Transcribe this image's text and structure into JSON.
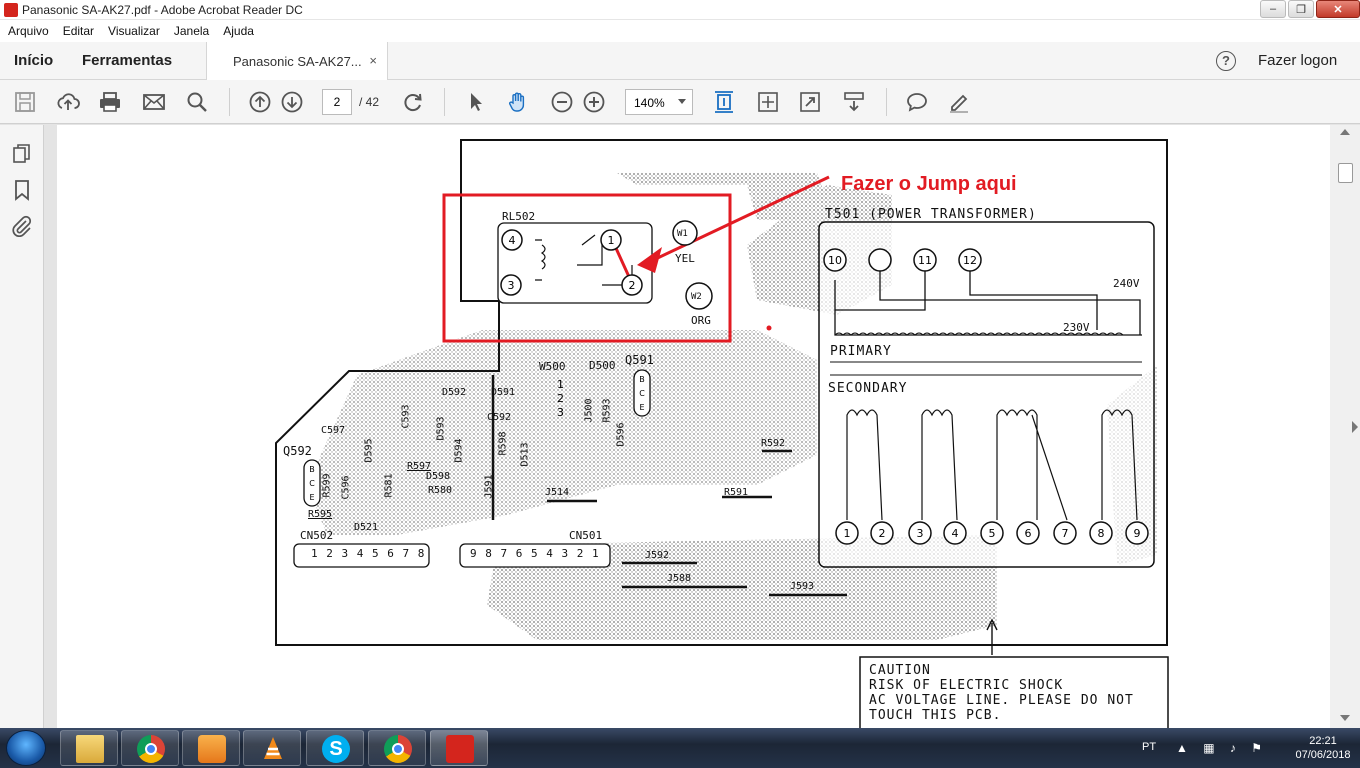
{
  "window": {
    "title": "Panasonic SA-AK27.pdf - Adobe Acrobat Reader DC"
  },
  "menu": [
    "Arquivo",
    "Editar",
    "Visualizar",
    "Janela",
    "Ajuda"
  ],
  "tabs": {
    "home": "Início",
    "tools": "Ferramentas",
    "document": "Panasonic SA-AK27...",
    "close": "×"
  },
  "account": {
    "help": "?",
    "login": "Fazer logon"
  },
  "toolbar": {
    "page_current": "2",
    "page_total": "/ 42",
    "zoom": "140%"
  },
  "document": {
    "annotation": "Fazer o Jump aqui",
    "caution": [
      "CAUTION",
      "RISK OF ELECTRIC SHOCK",
      "AC VOLTAGE LINE. PLEASE DO NOT",
      "TOUCH THIS PCB."
    ],
    "labels": {
      "rl502": "RL502",
      "t501": "T501 (POWER TRANSFORMER)",
      "primary": "PRIMARY",
      "secondary": "SECONDARY",
      "v240": "240V",
      "v230": "230V",
      "w1": "W1",
      "yel": "YEL",
      "w2": "W2",
      "org": "ORG",
      "w500": "W500",
      "d500": "D500",
      "q591": "Q591",
      "q592": "Q592",
      "cn502": "CN502",
      "cn501": "CN501",
      "d592": "D592",
      "d591": "D591",
      "c597": "C597",
      "c593": "C593",
      "c592": "C592",
      "d593": "D593",
      "d594": "D594",
      "d595": "D595",
      "r598": "R598",
      "d513": "D513",
      "r597": "R597",
      "d598": "D598",
      "r580": "R580",
      "r599": "R599",
      "c596": "C596",
      "r581": "R581",
      "r595": "R595",
      "d521": "D521",
      "j591": "J591",
      "j514": "J514",
      "j500": "J500",
      "r593": "R593",
      "r592": "R592",
      "r591": "R591",
      "j592": "J592",
      "j588": "J588",
      "j593": "J593",
      "d596": "D596"
    },
    "relay_pins": [
      "4",
      "1",
      "3",
      "2"
    ],
    "primary_pins": [
      "10",
      "11",
      "12"
    ],
    "secondary_pins": [
      "1",
      "2",
      "3",
      "4",
      "5",
      "6",
      "7",
      "8",
      "9"
    ],
    "cn502_pins": "1 2 3 4 5 6 7 8",
    "cn501_pins": "9 8 7 6 5 4 3 2 1",
    "w500_pins": [
      "1",
      "2",
      "3"
    ],
    "q_pins": [
      "B",
      "C",
      "E"
    ]
  },
  "tray": {
    "lang": "PT",
    "time": "22:21",
    "date": "07/06/2018"
  },
  "colors": {
    "annotation": "#e21b23",
    "taskbar": "#1c2636"
  }
}
